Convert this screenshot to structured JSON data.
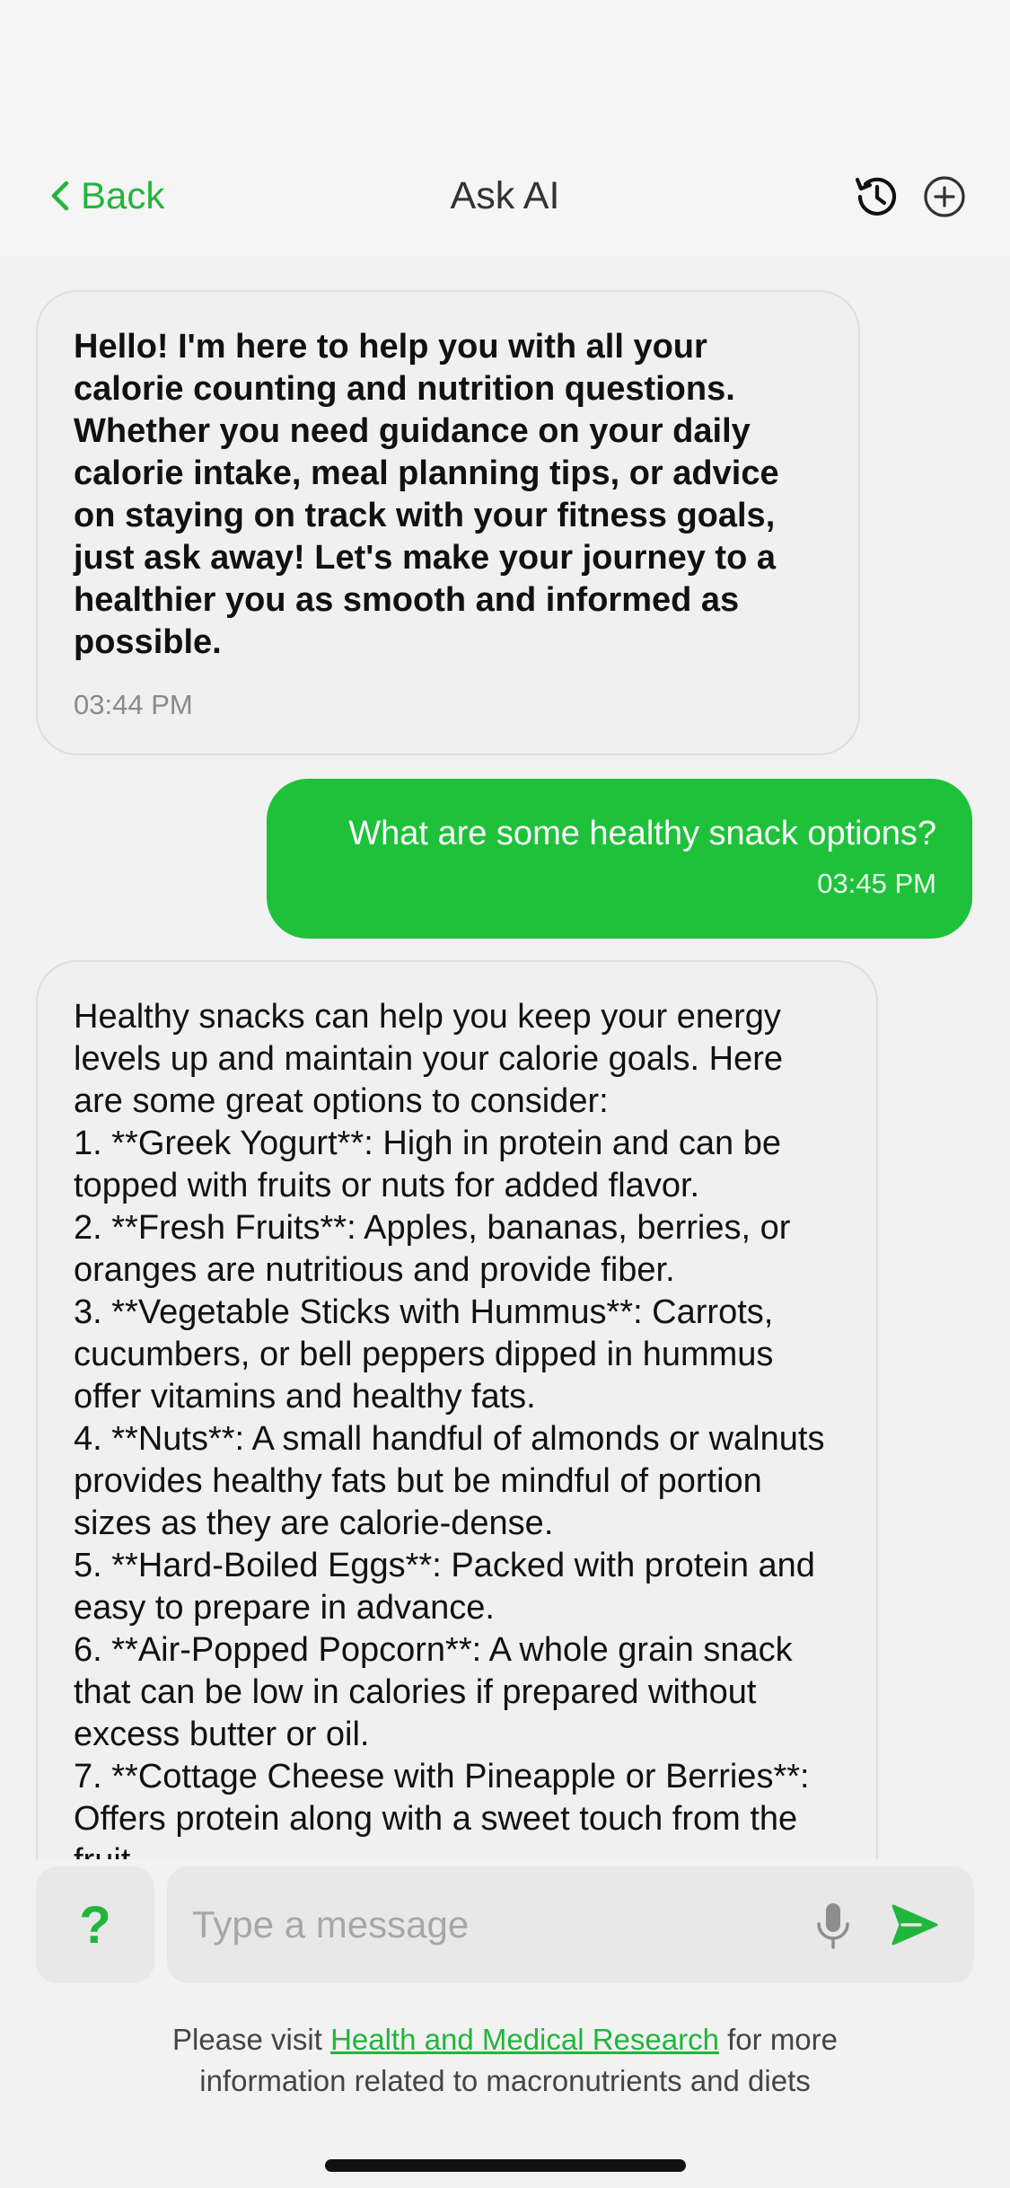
{
  "header": {
    "back_label": "Back",
    "title": "Ask AI",
    "history_icon": "history-icon",
    "new_chat_icon": "plus-circle-icon"
  },
  "messages": [
    {
      "role": "assistant",
      "text": "Hello! I'm here to help you with all your calorie counting and nutrition questions. Whether you need guidance on your daily calorie intake, meal planning tips, or advice on staying on track with your fitness goals, just ask away! Let's make your journey to a healthier you as smooth and informed as possible.",
      "time": "03:44 PM"
    },
    {
      "role": "user",
      "text": "What are some healthy snack options?",
      "time": "03:45 PM"
    },
    {
      "role": "assistant",
      "text": "Healthy snacks can help you keep your energy levels up and maintain your calorie goals. Here are some great options to consider:\n1. **Greek Yogurt**: High in protein and can be topped with fruits or nuts for added flavor.\n2. **Fresh Fruits**: Apples, bananas, berries, or oranges are nutritious and provide fiber.\n3. **Vegetable Sticks with Hummus**: Carrots, cucumbers, or bell peppers dipped in hummus offer vitamins and healthy fats.\n4. **Nuts**: A small handful of almonds or walnuts provides healthy fats but be mindful of portion sizes as they are calorie-dense.\n5. **Hard-Boiled Eggs**: Packed with protein and easy to prepare in advance.\n6. **Air-Popped Popcorn**: A whole grain snack that can be low in calories if prepared without excess butter or oil.\n7. **Cottage Cheese with Pineapple or Berries**: Offers protein along with a sweet touch from the fruit."
    }
  ],
  "composer": {
    "help_label": "?",
    "placeholder": "Type a message",
    "mic_icon": "microphone-icon",
    "send_icon": "send-icon"
  },
  "footer": {
    "prefix": "Please visit ",
    "link_label": "Health and Medical Research",
    "suffix_line1": " for more",
    "line2": "information related to macronutrients and diets"
  },
  "colors": {
    "accent": "#21b53c",
    "user_bubble": "#1fc13b",
    "background": "#f2f2f2"
  }
}
